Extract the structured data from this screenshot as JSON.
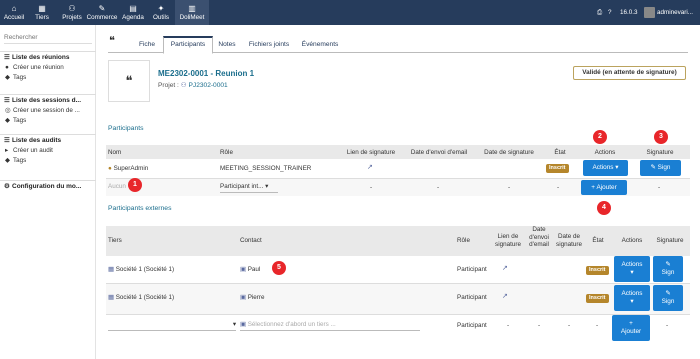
{
  "topnav": {
    "items": [
      {
        "label": "Accueil",
        "icon": "⌂"
      },
      {
        "label": "Tiers",
        "icon": "▦"
      },
      {
        "label": "Projets",
        "icon": "⚇"
      },
      {
        "label": "Commerce",
        "icon": "✎"
      },
      {
        "label": "Agenda",
        "icon": "▤"
      },
      {
        "label": "Outils",
        "icon": "✦"
      },
      {
        "label": "DoliMeet",
        "icon": "▥"
      }
    ],
    "version": "16.0.3",
    "user": "adminevari..."
  },
  "sidebar": {
    "search_placeholder": "Rechercher",
    "blocks": [
      {
        "title": "Liste des réunions",
        "links": [
          "Créer une réunion",
          "Tags"
        ]
      },
      {
        "title": "Liste des sessions d...",
        "links": [
          "Créer une session de ...",
          "Tags"
        ]
      },
      {
        "title": "Liste des audits",
        "links": [
          "Créer un audit",
          "Tags"
        ]
      },
      {
        "title": "Configuration du mo...",
        "links": []
      }
    ]
  },
  "tabs": [
    "Fiche",
    "Participants",
    "Notes",
    "Fichiers joints",
    "Événements"
  ],
  "object": {
    "ref": "ME2302-0001 - Reunion 1",
    "project_label": "Projet :",
    "project_value": "PJ2302-0001",
    "status": "Validé (en attente de signature)"
  },
  "participants": {
    "title": "Participants",
    "headers": [
      "Nom",
      "Rôle",
      "Lien de signature",
      "Date d'envoi d'email",
      "Date de signature",
      "État",
      "Actions",
      "Signature"
    ],
    "row": {
      "name": "SuperAdmin",
      "role": "MEETING_SESSION_TRAINER",
      "state": "Inscrit",
      "actions": "Actions ▾",
      "sign": "Sign"
    },
    "add_row": {
      "name_placeholder": "Aucun",
      "role": "Participant int...",
      "dash": "-",
      "add_label": "Ajouter"
    }
  },
  "external": {
    "title": "Participants externes",
    "headers": [
      "Tiers",
      "Contact",
      "Rôle",
      "Lien de signature",
      "Date d'envoi d'email",
      "Date de signature",
      "État",
      "Actions",
      "Signature"
    ],
    "rows": [
      {
        "tiers": "Société 1 (Société 1)",
        "contact": "Paul",
        "role": "Participant",
        "state": "Inscrit",
        "actions": "Actions",
        "sign": "Sign"
      },
      {
        "tiers": "Société 1 (Société 1)",
        "contact": "Pierre",
        "role": "Participant",
        "state": "Inscrit",
        "actions": "Actions",
        "sign": "Sign"
      }
    ],
    "add_row": {
      "contact_placeholder": "Sélectionnez d'abord un tiers ...",
      "role": "Participant",
      "dash": "-",
      "add_label": "Ajouter"
    }
  },
  "markers": [
    "1",
    "2",
    "3",
    "4",
    "5"
  ],
  "colors": {
    "topbar": "#263c5c",
    "accent": "#1a7fd3",
    "badge": "#b5862b",
    "marker": "#e8262a",
    "link": "#1a6d8c"
  }
}
